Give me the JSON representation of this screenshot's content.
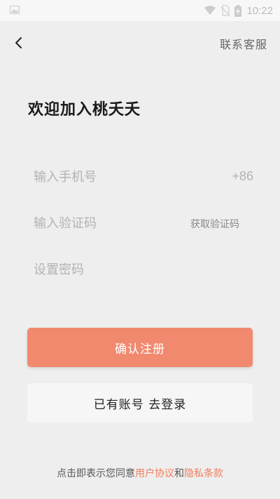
{
  "status_bar": {
    "time": "10:22",
    "icons": [
      "gallery-icon",
      "wifi-icon",
      "no-sim-icon",
      "battery-charging-icon"
    ]
  },
  "header": {
    "support_label": "联系客服"
  },
  "page_title": "欢迎加入桃夭夭",
  "form": {
    "phone_placeholder": "输入手机号",
    "country_code": "+86",
    "code_placeholder": "输入验证码",
    "get_code_label": "获取验证码",
    "password_placeholder": "设置密码"
  },
  "buttons": {
    "register_label": "确认注册",
    "login_label": "已有账号 去登录"
  },
  "agreement": {
    "prefix": "点击即表示您同意",
    "user_agreement": "用户协议",
    "and": "和",
    "privacy_policy": "隐私条款"
  },
  "colors": {
    "accent": "#f0896e",
    "link": "#ef7d5c",
    "background": "#eeeeee"
  }
}
